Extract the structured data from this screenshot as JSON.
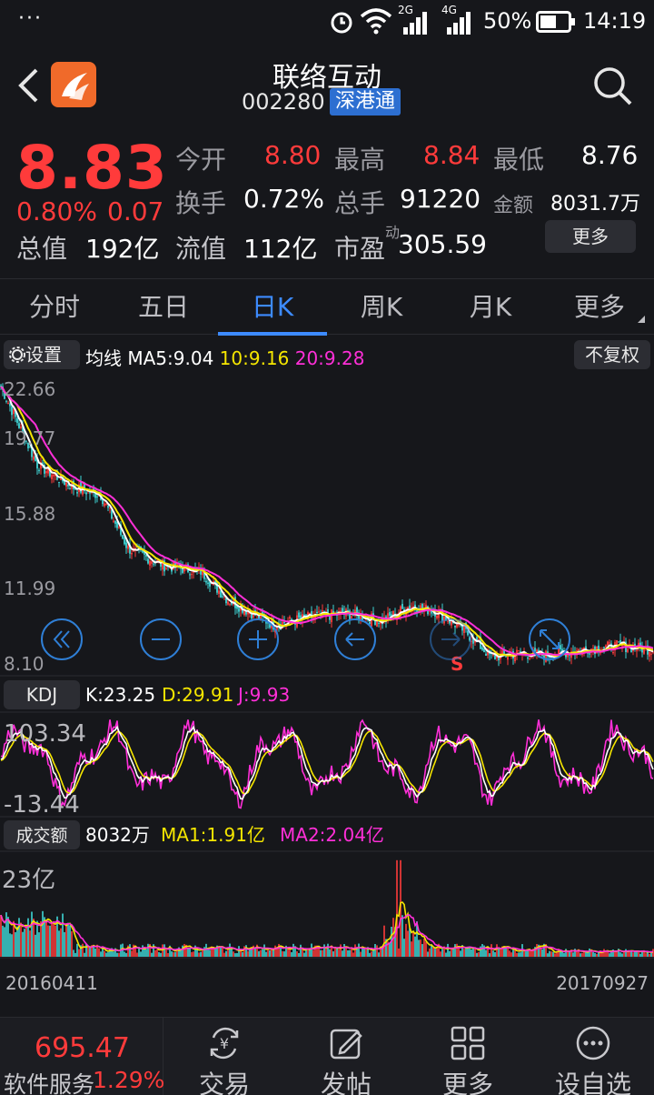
{
  "status_bar": {
    "time": "14:19",
    "battery": "50%",
    "net1": "2G",
    "net2": "4G",
    "dots": "···"
  },
  "header": {
    "stock_name": "联络互动",
    "stock_code": "002280",
    "tag": "深港通"
  },
  "quote": {
    "price": "8.83",
    "change_pct": "0.80%",
    "change": "0.07",
    "open_label": "今开",
    "open": "8.80",
    "high_label": "最高",
    "high": "8.84",
    "low_label": "最低",
    "low": "8.76",
    "turnover_label": "换手",
    "turnover": "0.72%",
    "volume_label": "总手",
    "volume": "91220",
    "amount_label": "金额",
    "amount": "8031.7万",
    "mcap_label": "总值",
    "mcap": "192亿",
    "float_label": "流值",
    "float": "112亿",
    "pe_label": "市盈",
    "pe_sup": "动",
    "pe": "305.59",
    "more": "更多"
  },
  "tabs": [
    "分时",
    "五日",
    "日K",
    "周K",
    "月K",
    "更多"
  ],
  "active_tab": 2,
  "kline_panel": {
    "settings": "设置",
    "ma_label": "均线",
    "ma5": "MA5:9.04",
    "ma10": "10:9.16",
    "ma20": "20:9.28",
    "adjust": "不复权",
    "y_labels": [
      "22.66",
      "19.77",
      "15.88",
      "11.99",
      "8.10"
    ],
    "marker": "S"
  },
  "kdj_panel": {
    "title": "KDJ",
    "k": "K:23.25",
    "d": "D:29.91",
    "j": "J:9.93",
    "y_top": "103.34",
    "y_bottom": "-13.44"
  },
  "volume_panel": {
    "title": "成交额",
    "value": "8032万",
    "ma1": "MA1:1.91亿",
    "ma2": "MA2:2.04亿",
    "y_top": "23亿",
    "date_start": "20160411",
    "date_end": "20170927"
  },
  "bottom_nav": {
    "index_value": "695.47",
    "index_name": "软件服务",
    "index_change": "1.29%",
    "items": [
      "交易",
      "发帖",
      "更多",
      "设自选"
    ]
  },
  "colors": {
    "up": "#ff3b3b",
    "down": "#3fd6d6",
    "ma5": "#ffffff",
    "ma10": "#f5e600",
    "ma20": "#ff2fd8",
    "accent": "#3d8bff"
  }
}
